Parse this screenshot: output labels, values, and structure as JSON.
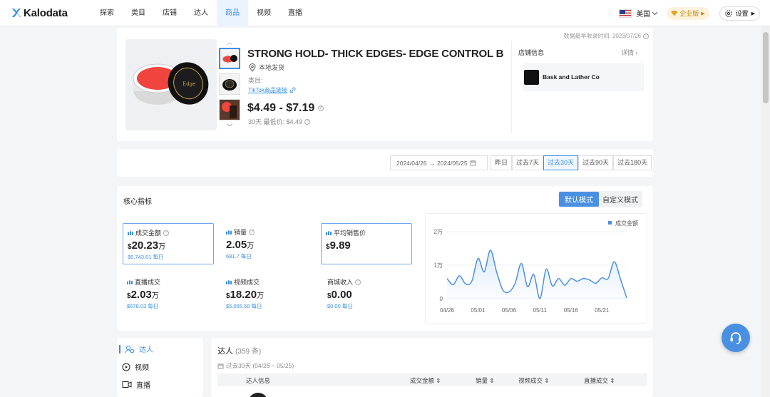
{
  "brand": "Kalodata",
  "nav": [
    "探索",
    "类目",
    "店铺",
    "达人",
    "商品",
    "视频",
    "直播"
  ],
  "region": "美国",
  "enterprise": "企业版",
  "settings": "设置",
  "product": {
    "title": "STRONG HOLD- THICK EDGES- EDGE CONTROL B...",
    "ship": "本地发货",
    "category_label": "类目:",
    "tiktok_link": "TikTok商品链接",
    "price": "$4.49 - $7.19",
    "min_price_note": "30天 最低价: $4.49",
    "data_time": "数据最早收录时间: 2023/07/26",
    "shop_info": "店铺信息",
    "detail": "详情",
    "shop_name": "Bask and Lather Co"
  },
  "date_range": {
    "from": "2024/04/26",
    "to": "2024/05/25",
    "arrow": "→",
    "presets": [
      "昨日",
      "过去7天",
      "过去30天",
      "过去90天",
      "过去180天"
    ],
    "active": "过去30天"
  },
  "metrics_section": {
    "title": "核心指标",
    "mode_default": "默认模式",
    "mode_custom": "自定义模式",
    "metrics": [
      {
        "label": "成交金额",
        "cur": "$",
        "value": "20.23",
        "unit": "万",
        "sub": "$6,743.61 每日",
        "info": true
      },
      {
        "label": "销量",
        "cur": "",
        "value": "2.05",
        "unit": "万",
        "sub": "681.7 每日",
        "info": true
      },
      {
        "label": "平均销售价",
        "cur": "$",
        "value": "9.89",
        "unit": "",
        "sub": "",
        "info": false
      },
      {
        "label": "直播成交",
        "cur": "$",
        "value": "2.03",
        "unit": "万",
        "sub": "$678.03 每日",
        "info": false
      },
      {
        "label": "视频成交",
        "cur": "$",
        "value": "18.20",
        "unit": "万",
        "sub": "$6,065.58 每日",
        "info": false
      },
      {
        "label": "商城收入",
        "cur": "$",
        "value": "0.00",
        "unit": "",
        "sub": "$0.00 每日",
        "info": true
      }
    ]
  },
  "chart_data": {
    "type": "area",
    "legend": "成交金额",
    "y_ticks": [
      "2万",
      "1万",
      "0"
    ],
    "ylim": [
      0,
      20000
    ],
    "x_ticks": [
      "04/26",
      "05/01",
      "05/06",
      "05/11",
      "05/16",
      "05/21"
    ],
    "x": [
      "04/26",
      "04/27",
      "04/28",
      "04/29",
      "04/30",
      "05/01",
      "05/02",
      "05/03",
      "05/04",
      "05/05",
      "05/06",
      "05/07",
      "05/08",
      "05/09",
      "05/10",
      "05/11",
      "05/12",
      "05/13",
      "05/14",
      "05/15",
      "05/16",
      "05/17",
      "05/18",
      "05/19",
      "05/20",
      "05/21",
      "05/22",
      "05/23",
      "05/24",
      "05/25"
    ],
    "series": [
      {
        "name": "成交金额",
        "values": [
          6000,
          4200,
          6800,
          4400,
          5200,
          12000,
          8000,
          14500,
          8000,
          2600,
          2000,
          4600,
          10500,
          3600,
          7200,
          0,
          8800,
          3800,
          6000,
          4000,
          6000,
          5200,
          6000,
          5600,
          4600,
          6200,
          6000,
          11000,
          5800,
          200
        ]
      }
    ]
  },
  "side_menu": [
    "达人",
    "视频",
    "直播"
  ],
  "creators": {
    "title": "达人",
    "count": "(359 条)",
    "range": "过去30天 (04/26 ~ 05/25)",
    "columns": [
      "达人信息",
      "成交金额",
      "销量",
      "视频成交",
      "直播成交"
    ]
  }
}
